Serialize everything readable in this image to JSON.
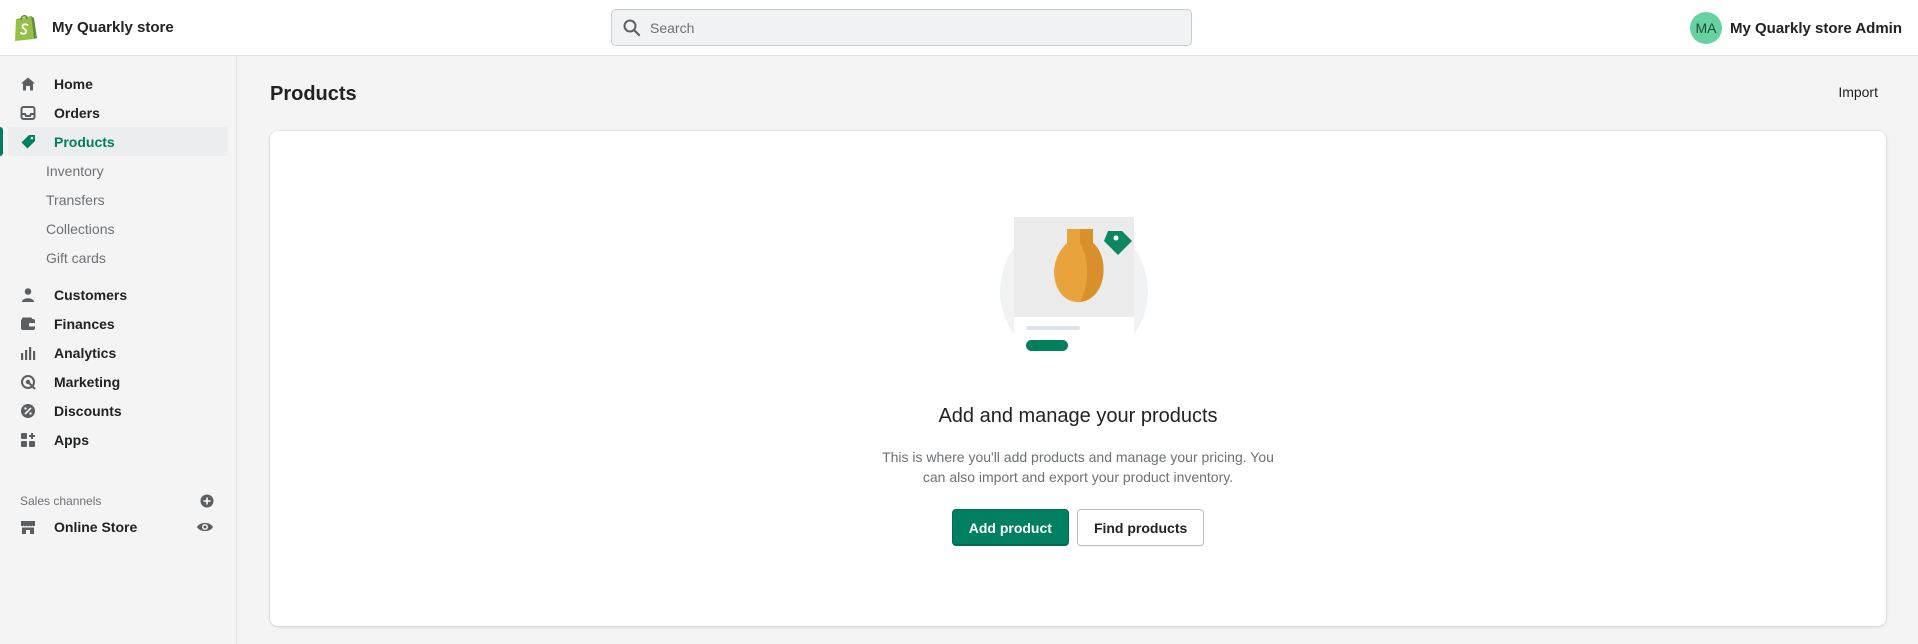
{
  "topbar": {
    "store_name": "My Quarkly store",
    "search_placeholder": "Search",
    "user_initials": "MA",
    "user_name": "My Quarkly store Admin"
  },
  "sidebar": {
    "items": [
      {
        "label": "Home",
        "icon": "home-icon"
      },
      {
        "label": "Orders",
        "icon": "inbox-icon"
      },
      {
        "label": "Products",
        "icon": "tag-icon",
        "active": true
      }
    ],
    "product_subitems": [
      "Inventory",
      "Transfers",
      "Collections",
      "Gift cards"
    ],
    "items2": [
      {
        "label": "Customers",
        "icon": "person-icon"
      },
      {
        "label": "Finances",
        "icon": "wallet-icon"
      },
      {
        "label": "Analytics",
        "icon": "bar-chart-icon"
      },
      {
        "label": "Marketing",
        "icon": "target-icon"
      },
      {
        "label": "Discounts",
        "icon": "discount-icon"
      },
      {
        "label": "Apps",
        "icon": "apps-icon"
      }
    ],
    "sales_channels_label": "Sales channels",
    "online_store_label": "Online Store"
  },
  "main": {
    "title": "Products",
    "import_label": "Import",
    "empty_title": "Add and manage your products",
    "empty_text": "This is where you'll add products and manage your pricing. You can also import and export your product inventory.",
    "add_product_label": "Add product",
    "find_products_label": "Find products"
  },
  "colors": {
    "accent": "#008060",
    "active_text": "#007f5f",
    "avatar": "#66d2a1"
  }
}
